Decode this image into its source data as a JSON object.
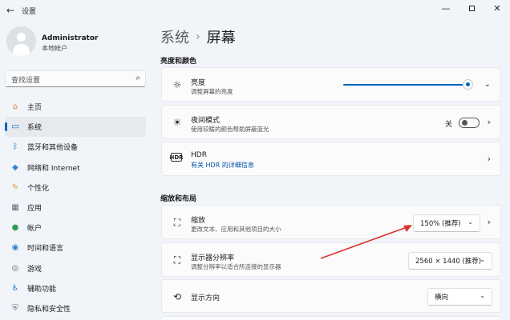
{
  "window": {
    "title": "设置",
    "back_icon": "back-arrow-icon",
    "min": "—",
    "close": "✕"
  },
  "user": {
    "name": "Administrator",
    "account": "本地帐户"
  },
  "search": {
    "placeholder": "查找设置"
  },
  "sidebar": {
    "items": [
      {
        "label": "主页",
        "icon": "home-icon",
        "glyph": "⌂",
        "color": "#e07b39"
      },
      {
        "label": "系统",
        "icon": "monitor-icon",
        "glyph": "▭",
        "color": "#0067c0",
        "active": true
      },
      {
        "label": "蓝牙和其他设备",
        "icon": "bluetooth-icon",
        "glyph": "ᛒ",
        "color": "#0078d4"
      },
      {
        "label": "网络和 Internet",
        "icon": "wifi-icon",
        "glyph": "◆",
        "color": "#3a86d6"
      },
      {
        "label": "个性化",
        "icon": "brush-icon",
        "glyph": "✎",
        "color": "#e0a030"
      },
      {
        "label": "应用",
        "icon": "apps-icon",
        "glyph": "▦",
        "color": "#5b6b7c"
      },
      {
        "label": "帐户",
        "icon": "account-icon",
        "glyph": "●",
        "color": "#2e9d59"
      },
      {
        "label": "时间和语言",
        "icon": "globe-clock-icon",
        "glyph": "◉",
        "color": "#2f7fd0"
      },
      {
        "label": "游戏",
        "icon": "gamepad-icon",
        "glyph": "◎",
        "color": "#6b6b6b"
      },
      {
        "label": "辅助功能",
        "icon": "accessibility-icon",
        "glyph": "♿",
        "color": "#1f6fc5"
      },
      {
        "label": "隐私和安全性",
        "icon": "shield-icon",
        "glyph": "⛨",
        "color": "#6d7580"
      }
    ]
  },
  "breadcrumb": {
    "parent": "系统",
    "separator": "›",
    "current": "屏幕"
  },
  "sections": {
    "brightness_color": "亮度和颜色",
    "scale_layout": "缩放和布局"
  },
  "cards": {
    "brightness": {
      "title": "亮度",
      "subtitle": "调整屏幕的亮度",
      "value_fraction": 0.97
    },
    "night_light": {
      "title": "夜间模式",
      "subtitle": "使用较暖的颜色帮助屏蔽蓝光",
      "toggle_label": "关",
      "on": false
    },
    "hdr": {
      "title": "HDR",
      "link": "有关 HDR 的详细信息"
    },
    "scale": {
      "title": "缩放",
      "subtitle": "更改文本、应用和其他项目的大小",
      "value": "150% (推荐)"
    },
    "resolution": {
      "title": "显示器分辨率",
      "subtitle": "调整分辨率以适合所连接的显示器",
      "value": "2560 × 1440 (推荐)"
    },
    "orientation": {
      "title": "显示方向",
      "value": "横向"
    }
  },
  "colors": {
    "accent": "#0067c0",
    "annotation_arrow": "#d9342b"
  }
}
